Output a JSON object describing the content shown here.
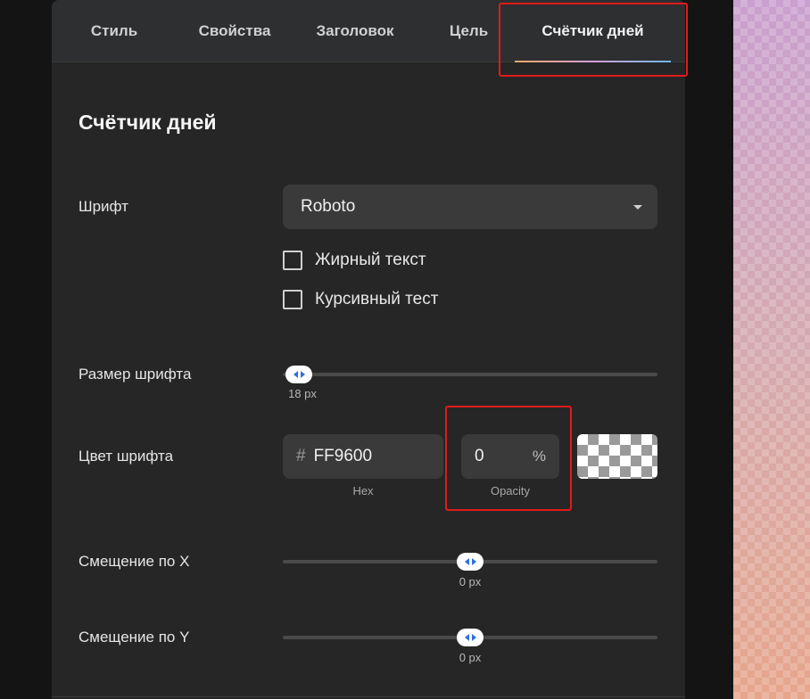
{
  "tabs": [
    {
      "label": "Стиль"
    },
    {
      "label": "Свойства"
    },
    {
      "label": "Заголовок"
    },
    {
      "label": "Цель"
    },
    {
      "label": "Счётчик дней",
      "active": true
    }
  ],
  "section": {
    "title": "Счётчик дней"
  },
  "font": {
    "label": "Шрифт",
    "value": "Roboto",
    "bold_label": "Жирный текст",
    "bold_checked": false,
    "italic_label": "Курсивный тест",
    "italic_checked": false
  },
  "font_size": {
    "label": "Размер шрифта",
    "value": "18 px",
    "level_fraction": 0.03
  },
  "font_color": {
    "label": "Цвет шрифта",
    "hash": "#",
    "hex": "FF9600",
    "hex_caption": "Hex",
    "opacity": "0",
    "percent": "%",
    "opacity_caption": "Opacity"
  },
  "offset_x": {
    "label": "Смещение по X",
    "value": "0 px",
    "level_fraction": 0.5
  },
  "offset_y": {
    "label": "Смещение по Y",
    "value": "0 px",
    "level_fraction": 0.5
  },
  "colors": {
    "accent": "#2f6fe0",
    "highlight": "#e01b1b"
  }
}
